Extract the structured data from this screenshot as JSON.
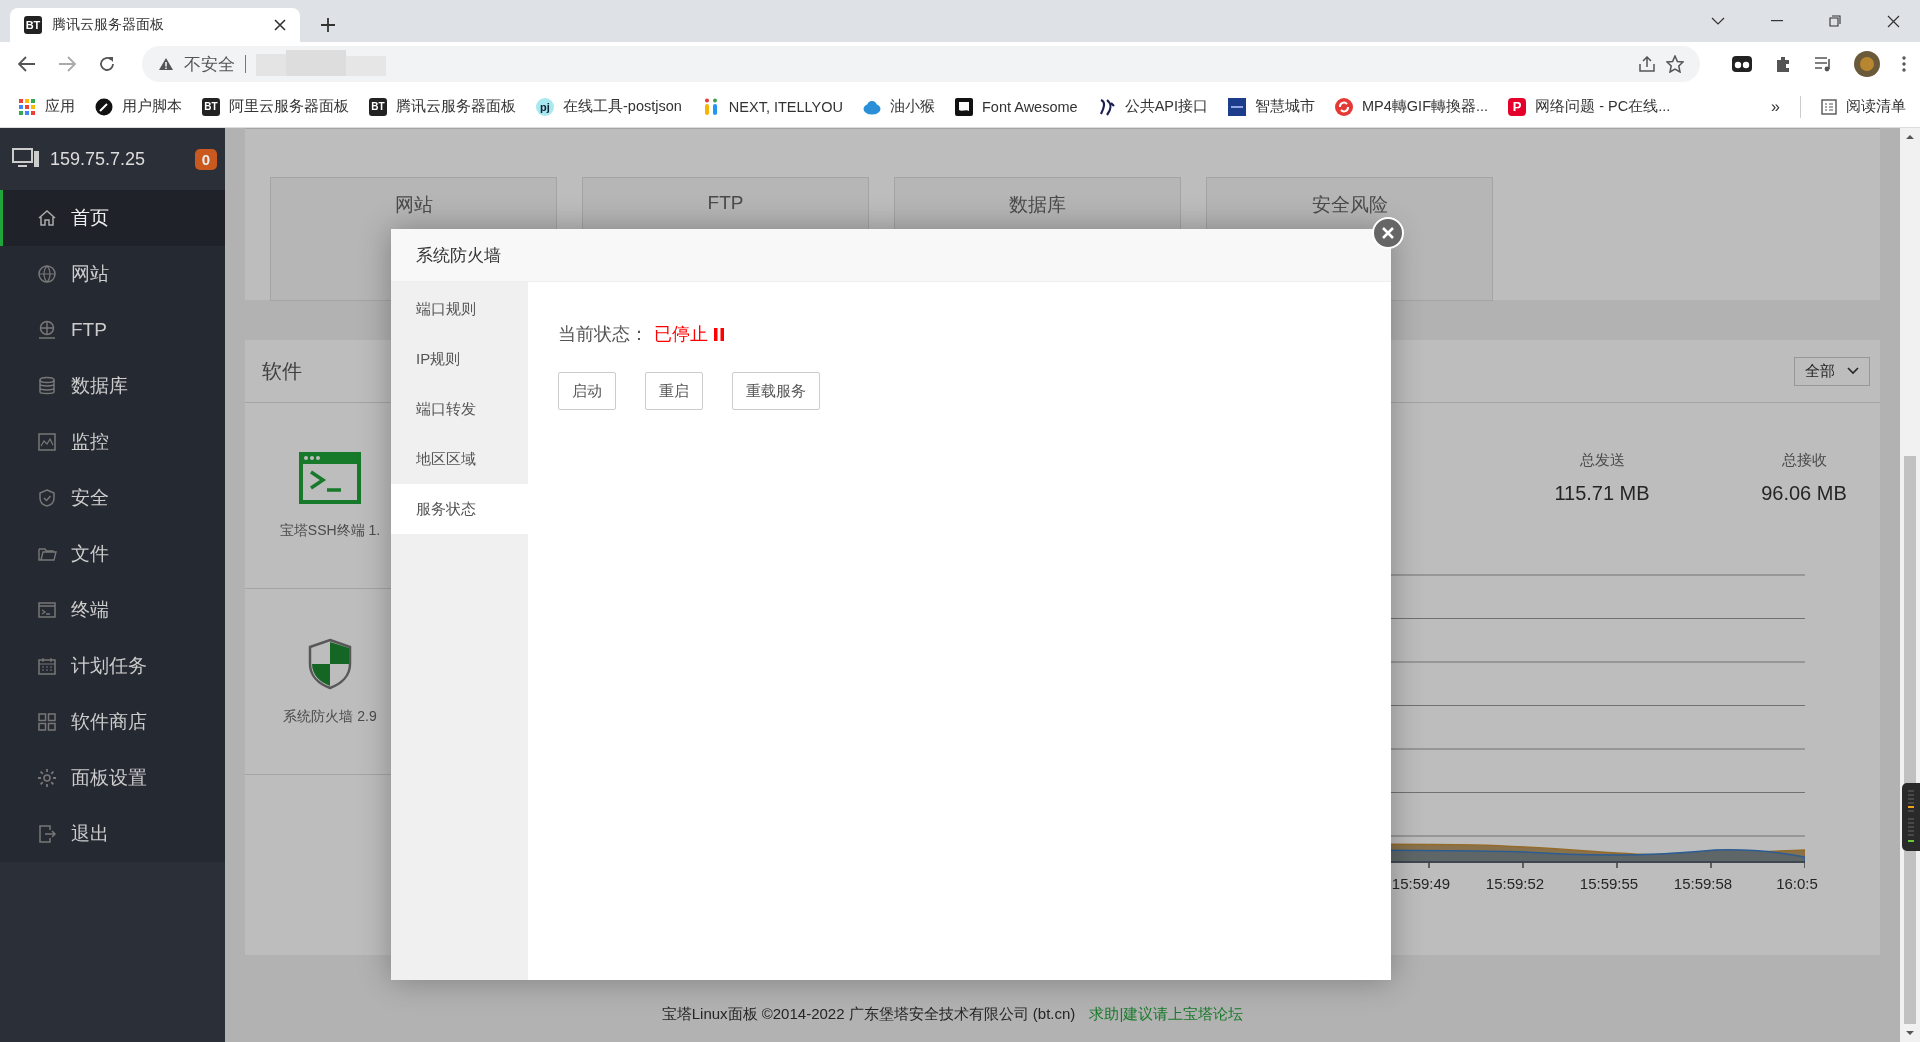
{
  "browser": {
    "tabs": [
      {
        "title": "腾讯云服务器面板",
        "icon_text": "BT",
        "selected": true
      }
    ],
    "address": {
      "security_label": "不安全"
    },
    "bookmarks": [
      {
        "label": "应用",
        "kind": "apps"
      },
      {
        "label": "用户脚本",
        "kind": "script"
      },
      {
        "label": "阿里云服务器面板",
        "kind": "text",
        "icon_text": "BT"
      },
      {
        "label": "腾讯云服务器面板",
        "kind": "text",
        "icon_text": "BT"
      },
      {
        "label": "在线工具-postjson",
        "kind": "bubble",
        "icon_text": "pj"
      },
      {
        "label": "NEXT, ITELLYOU",
        "kind": "drops"
      },
      {
        "label": "油小猴",
        "kind": "cloud"
      },
      {
        "label": "Font Awesome",
        "kind": "flag"
      },
      {
        "label": "公共API接口",
        "kind": "brush"
      },
      {
        "label": "智慧城市",
        "kind": "square"
      },
      {
        "label": "MP4轉GIF轉換器...",
        "kind": "cycle"
      },
      {
        "label": "网络问题 - PC在线...",
        "kind": "ptag",
        "icon_text": "P"
      }
    ],
    "overflow": "»",
    "reading_list": "阅读清单"
  },
  "sidebar": {
    "host": "159.75.7.25",
    "badge": "0",
    "items": [
      {
        "label": "首页",
        "kind": "home",
        "selected": true
      },
      {
        "label": "网站",
        "kind": "globe",
        "selected": false
      },
      {
        "label": "FTP",
        "kind": "ftp",
        "selected": false
      },
      {
        "label": "数据库",
        "kind": "database",
        "selected": false
      },
      {
        "label": "监控",
        "kind": "monitor",
        "selected": false
      },
      {
        "label": "安全",
        "kind": "shield",
        "selected": false
      },
      {
        "label": "文件",
        "kind": "folder",
        "selected": false
      },
      {
        "label": "终端",
        "kind": "terminal",
        "selected": false
      },
      {
        "label": "计划任务",
        "kind": "calendar",
        "selected": false
      },
      {
        "label": "软件商店",
        "kind": "grid",
        "selected": false
      },
      {
        "label": "面板设置",
        "kind": "gear",
        "selected": false
      },
      {
        "label": "退出",
        "kind": "exit",
        "selected": false
      }
    ]
  },
  "overview": [
    {
      "label": "网站"
    },
    {
      "label": "FTP"
    },
    {
      "label": "数据库"
    },
    {
      "label": "安全风险"
    }
  ],
  "software": {
    "title": "软件",
    "filter": "全部",
    "items": [
      {
        "label": "宝塔SSH终端 1.",
        "kind": "terminal"
      },
      {
        "label": "系统防火墙 2.9",
        "kind": "shield"
      }
    ]
  },
  "network": {
    "stats": [
      {
        "label": "总发送",
        "value": "115.71 MB"
      },
      {
        "label": "总接收",
        "value": "96.06 MB"
      }
    ],
    "time_labels": [
      "15:59:49",
      "15:59:52",
      "15:59:55",
      "15:59:58",
      "16:0:5"
    ]
  },
  "modal": {
    "title": "系统防火墙",
    "tabs": [
      {
        "label": "端口规则",
        "selected": false
      },
      {
        "label": "IP规则",
        "selected": false
      },
      {
        "label": "端口转发",
        "selected": false
      },
      {
        "label": "地区区域",
        "selected": false
      },
      {
        "label": "服务状态",
        "selected": true
      }
    ],
    "status_label": "当前状态：",
    "status_value": "已停止",
    "running": false,
    "buttons": [
      "启动",
      "重启",
      "重载服务"
    ]
  },
  "footer": {
    "text": "宝塔Linux面板 ©2014-2022 广东堡塔安全技术有限公司 (bt.cn)",
    "link": "求助|建议请上宝塔论坛"
  }
}
